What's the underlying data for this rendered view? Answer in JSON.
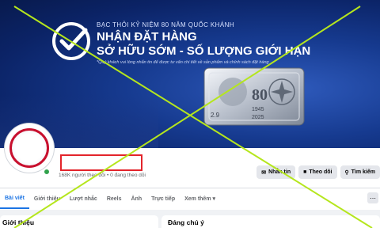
{
  "cover": {
    "kicker": "BẠC THỎI KỶ NIỆM 80 NĂM QUỐC KHÁNH",
    "headline1": "NHẬN ĐẶT HÀNG",
    "headline2": "SỞ HỮU SỚM - SỐ LƯỢNG GIỚI HẠN",
    "note": "*Quý khách vui lòng nhắn tin để được tư vấn chi tiết về sản phẩm và chính sách đặt hàng",
    "bar_number": "80",
    "bar_years_left": "2.9",
    "bar_year_start": "1945",
    "bar_year_end": "2025"
  },
  "profile": {
    "stats": "168K người theo dõi • 0 đang theo dõi"
  },
  "actions": [
    {
      "icon": "message-icon",
      "label": "Nhắn tin"
    },
    {
      "icon": "follow-icon",
      "label": "Theo dõi"
    },
    {
      "icon": "search-icon",
      "label": "Tìm kiếm"
    }
  ],
  "tabs": [
    "Bài viết",
    "Giới thiệu",
    "Lượt nhắc",
    "Reels",
    "Ảnh",
    "Trực tiếp",
    "Xem thêm ▾"
  ],
  "sections": {
    "left_title": "Giới thiệu",
    "right_title": "Đáng chú ý"
  },
  "colors": {
    "accent": "#1b74e4",
    "cross": "#b5e61d",
    "highlight_box": "#e3242b"
  }
}
